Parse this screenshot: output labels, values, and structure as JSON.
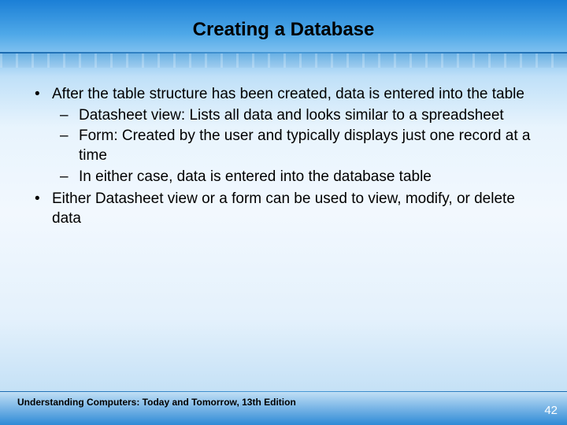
{
  "title": "Creating a Database",
  "bullets": {
    "l1_0": "After the table structure has been created, data is entered into the table",
    "l2_0": "Datasheet view: Lists all data and looks similar to a spreadsheet",
    "l2_1": "Form: Created by the user and typically displays just one record at a time",
    "l2_2": "In either case, data is entered into the database table",
    "l1_1": "Either Datasheet view or a form can be used to view, modify, or delete data"
  },
  "footer": "Understanding Computers: Today and Tomorrow, 13th Edition",
  "page": "42"
}
